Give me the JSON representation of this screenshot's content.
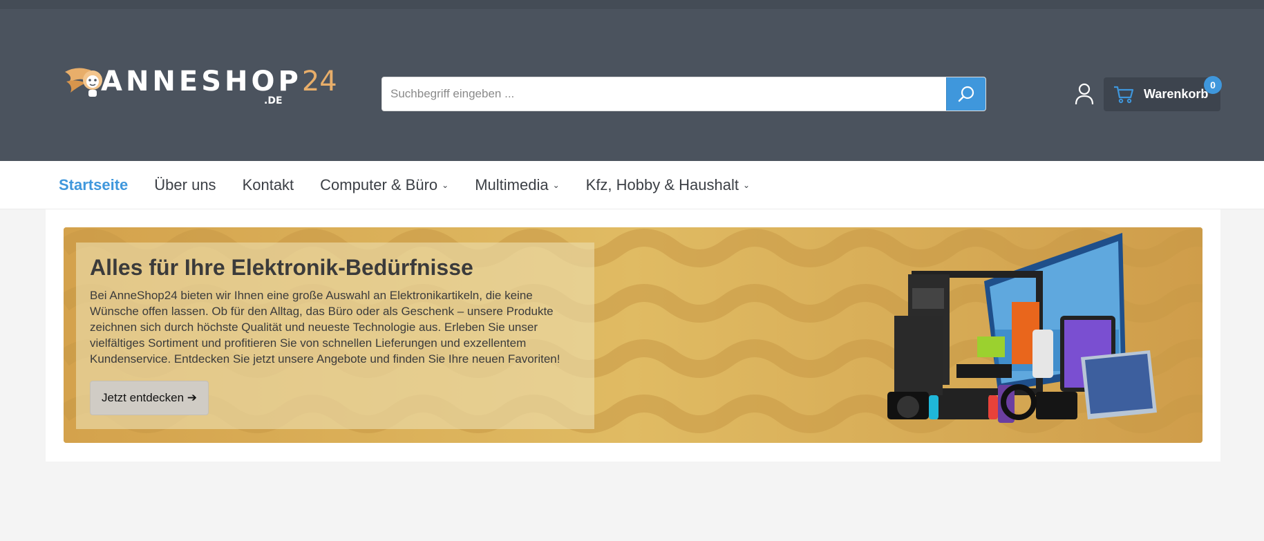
{
  "header": {
    "logo_text": "ANNESHOP",
    "logo_number": "24",
    "logo_suffix": ".DE",
    "search_placeholder": "Suchbegriff eingeben ...",
    "cart_label": "Warenkorb",
    "cart_count": "0",
    "icons": {
      "search": "search-icon",
      "account": "user-icon",
      "cart": "cart-icon"
    }
  },
  "nav": {
    "items": [
      {
        "label": "Startseite",
        "active": true
      },
      {
        "label": "Über uns"
      },
      {
        "label": "Kontakt"
      },
      {
        "label": "Computer & Büro",
        "dropdown": true
      },
      {
        "label": "Multimedia",
        "dropdown": true
      },
      {
        "label": "Kfz, Hobby & Haushalt",
        "dropdown": true
      }
    ]
  },
  "banner": {
    "title": "Alles für Ihre Elektronik-Bedürfnisse",
    "text": "Bei AnneShop24 bieten wir Ihnen eine große Auswahl an Elektronikartikeln, die keine Wünsche offen lassen. Ob für den Alltag, das Büro oder als Geschenk – unsere Produkte zeichnen sich durch höchste Qualität und neueste Technologie aus. Erleben Sie unser vielfältiges Sortiment und profitieren Sie von schnellen Lieferungen und exzellentem Kundenservice. Entdecken Sie jetzt unsere Angebote und finden Sie Ihre neuen Favoriten!",
    "button_label": "Jetzt entdecken ➔"
  },
  "colors": {
    "header_bg": "#4b535e",
    "accent": "#3f97dc",
    "banner_gold": "#d9b05a"
  }
}
